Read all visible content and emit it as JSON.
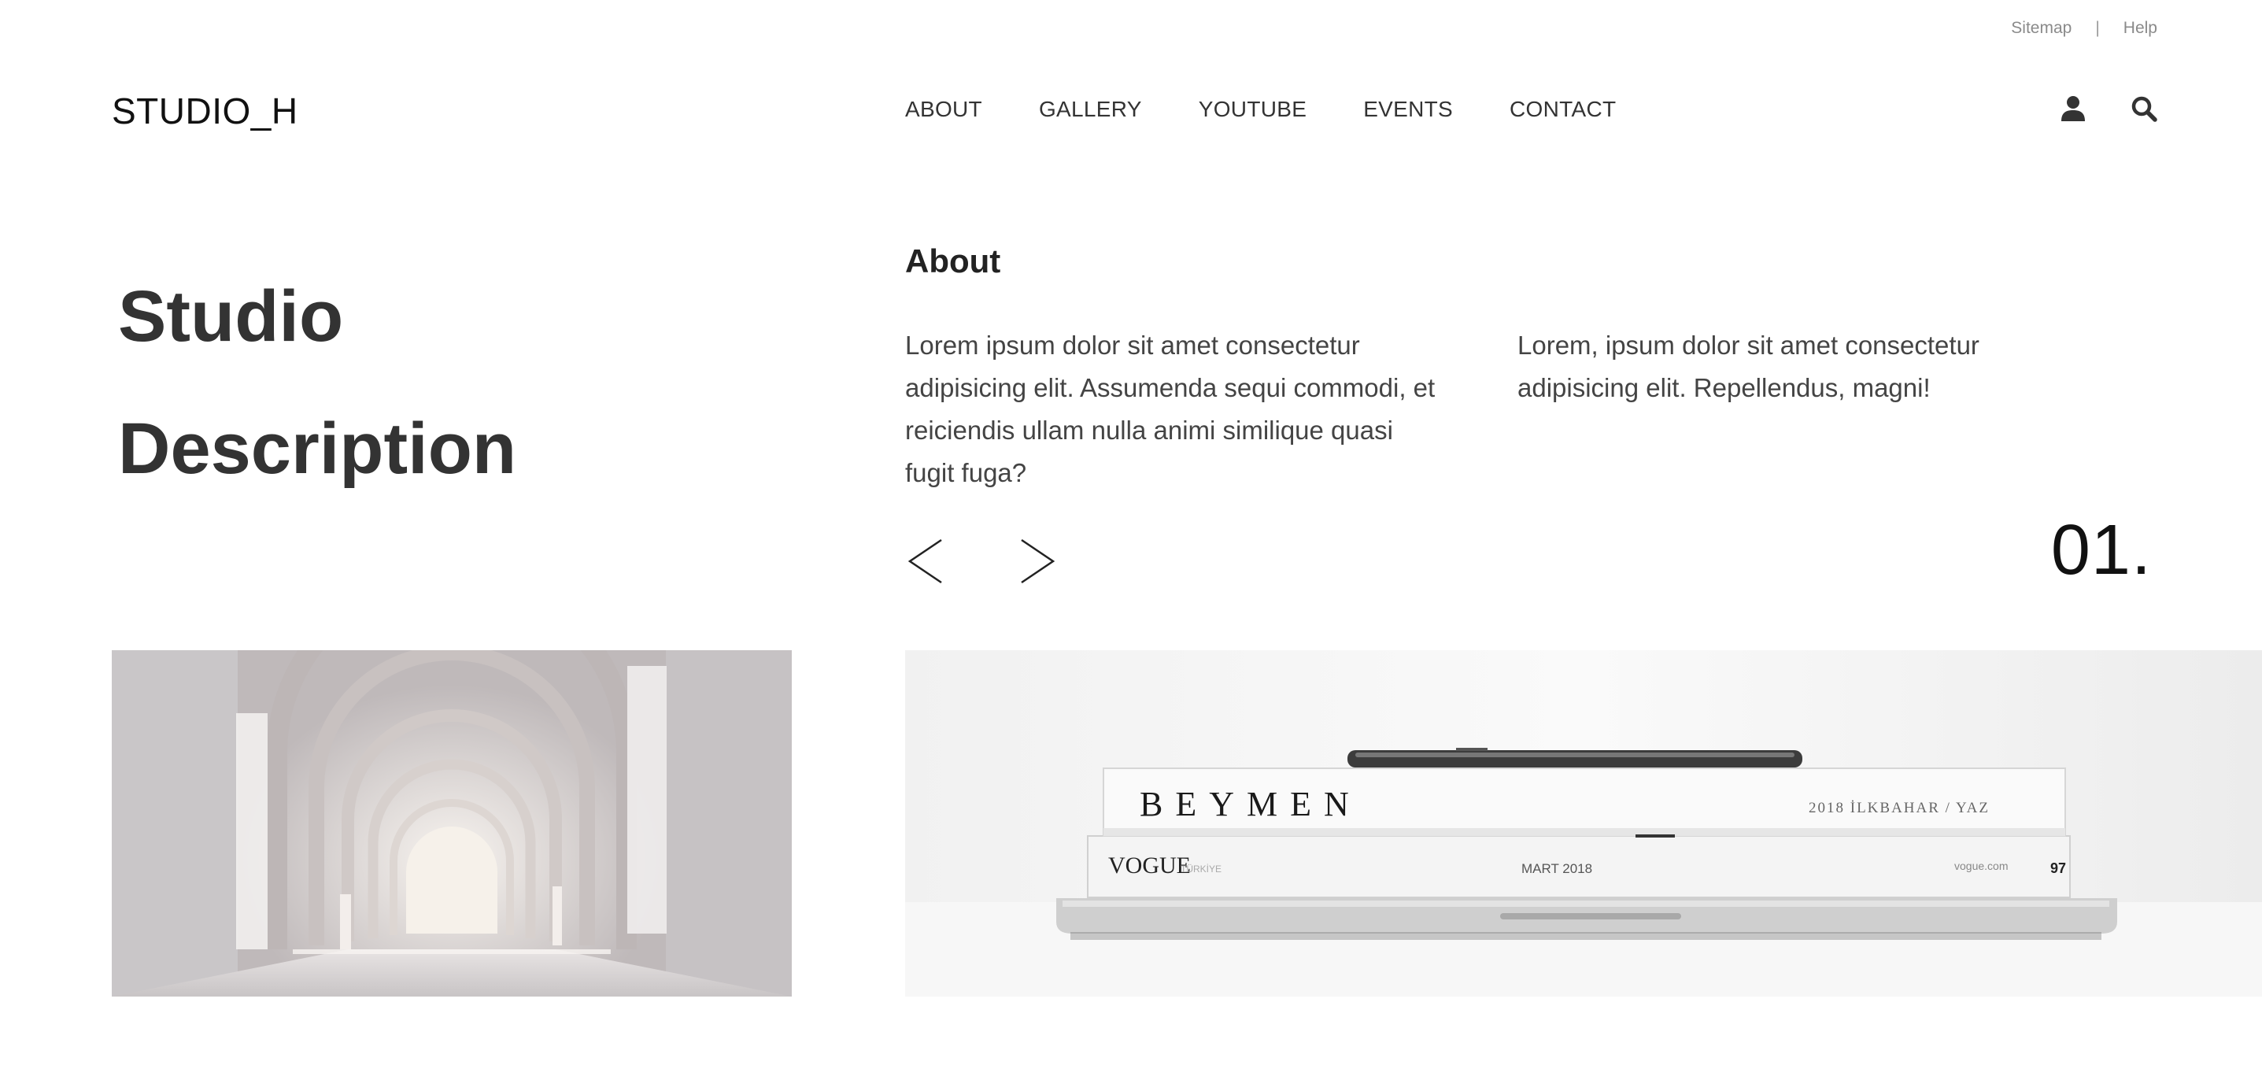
{
  "utility": {
    "sitemap": "Sitemap",
    "separator": "|",
    "help": "Help"
  },
  "header": {
    "logo": "STUDIO_H",
    "nav": [
      "ABOUT",
      "GALLERY",
      "YOUTUBE",
      "EVENTS",
      "CONTACT"
    ],
    "icons": [
      "user-icon",
      "search-icon"
    ]
  },
  "hero": {
    "title_line1": "Studio",
    "title_line2": "Description"
  },
  "about": {
    "heading": "About",
    "paragraph1": "Lorem ipsum dolor sit amet consectetur adipisicing elit. Assumenda sequi commodi, et reiciendis ullam nulla animi similique quasi fugit fuga?",
    "paragraph2": "Lorem, ipsum dolor sit amet consectetur adipisicing elit. Repellendus, magni!"
  },
  "slider": {
    "counter": "01.",
    "prev_icon": "chevron-left-icon",
    "next_icon": "chevron-right-icon"
  },
  "images": {
    "right_cover_text": "BEYMEN",
    "right_cover_subtext": "2018 İLKBAHAR / YAZ",
    "right_magazine_title": "VOGUE",
    "right_magazine_subtitle": "TÜRKİYE",
    "right_magazine_date": "MART 2018",
    "right_magazine_url": "vogue.com",
    "right_magazine_number": "97"
  },
  "colors": {
    "text": "#333333",
    "muted": "#8a8a8a",
    "background": "#ffffff"
  }
}
